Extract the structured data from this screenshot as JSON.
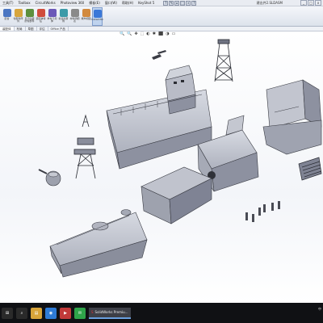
{
  "menubar": {
    "items": [
      "工具(T)",
      "Toolbox",
      "CircuitWorks",
      "Photoview 360",
      "模板(E)",
      "窗口(W)",
      "帮助(H)",
      "KeyShot 5"
    ],
    "doc_title": "建出件2.SLDASM",
    "win_buttons": [
      "_",
      "□",
      "x"
    ]
  },
  "quick_access": [
    "?",
    "✎",
    "⌂",
    "⬚",
    "⌕",
    "?"
  ],
  "ribbon": {
    "buttons": [
      {
        "label": "配合",
        "icon_color": "#4b76c2"
      },
      {
        "label": "零部件阵列",
        "icon_color": "#d7a53d"
      },
      {
        "label": "显示隐藏的零部件",
        "icon_color": "#5d8f3d"
      },
      {
        "label": "装配体特征",
        "icon_color": "#d04d3d"
      },
      {
        "label": "参考几何体",
        "icon_color": "#6b58b8"
      },
      {
        "label": "新运动算例",
        "icon_color": "#3c9aa8"
      },
      {
        "label": "材料明细表",
        "icon_color": "#8a8a8a"
      },
      {
        "label": "爆炸视图",
        "icon_color": "#d28a3e"
      },
      {
        "label": "Instant3D",
        "icon_color": "#3b78d8"
      }
    ]
  },
  "tabs": [
    "装配体",
    "布局",
    "草图",
    "评估",
    "Office 产品"
  ],
  "selected_tab": "装配体",
  "hud_icons": [
    "🔍",
    "🔍",
    "✥",
    "⬚",
    "◐",
    "✱",
    "⬛",
    "◑",
    "▭"
  ],
  "taskbar": {
    "icons": [
      {
        "name": "start-icon",
        "glyph": "⊞",
        "color": "#2a2a2a"
      },
      {
        "name": "search-icon",
        "glyph": "⌕",
        "color": "#2a2a2a"
      },
      {
        "name": "explorer-icon",
        "glyph": "▤",
        "color": "#d8a43a"
      },
      {
        "name": "browser-icon",
        "glyph": "◉",
        "color": "#2e7bd6"
      },
      {
        "name": "media-icon",
        "glyph": "▶",
        "color": "#c23a3a"
      },
      {
        "name": "chat-icon",
        "glyph": "✉",
        "color": "#2fa44a"
      }
    ],
    "active_task": "SolidWorks Premiu...",
    "tray_text": "中"
  }
}
